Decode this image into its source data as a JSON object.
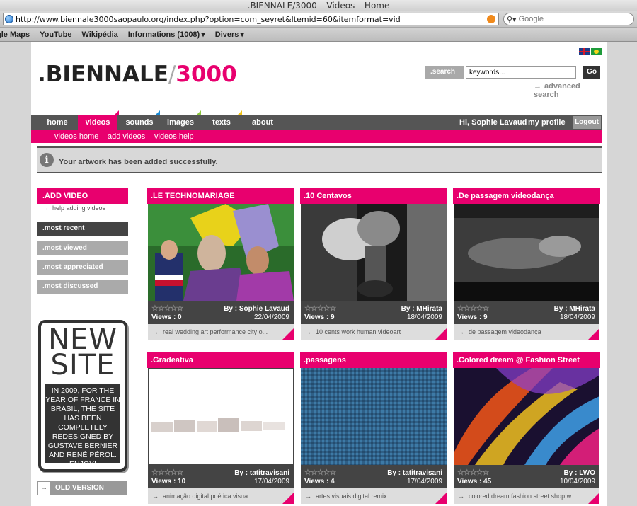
{
  "browser": {
    "title": ".BIENNALE/3000 – Videos – Home",
    "url": "http://www.biennale3000saopaulo.org/index.php?option=com_seyret&Itemid=60&itemformat=vid",
    "search_placeholder": "Google",
    "bookmarks": [
      "gle Maps",
      "YouTube",
      "Wikipédia",
      "Informations (1008)",
      "Divers"
    ]
  },
  "header": {
    "logo_part1": ".BIENNALE",
    "logo_slash": "/",
    "logo_part2": "3000",
    "search_label": ".search",
    "search_value": "keywords...",
    "go_label": "Go",
    "advanced_search": "advanced search"
  },
  "nav": {
    "items": [
      "home",
      "videos",
      "sounds",
      "images",
      "texts",
      "about"
    ],
    "greeting": "Hi, Sophie Lavaud",
    "profile": "my profile",
    "logout": "Logout",
    "sub": [
      "videos home",
      "add videos",
      "videos help"
    ]
  },
  "message": "Your artwork has been added successfully.",
  "sidebar": {
    "add_video": ".ADD VIDEO",
    "help": "help adding videos",
    "filters": [
      ".most recent",
      ".most viewed",
      ".most appreciated",
      ".most discussed"
    ],
    "newsite_big": "NEW SITE",
    "newsite_small": "IN 2009, FOR THE YEAR OF FRANCE IN BRASIL, THE SITE HAS BEEN COMPLETELY REDESIGNED BY GUSTAVE BERNIER AND RENÉ PÉROL. ENJOY!",
    "old_version": "OLD VERSION"
  },
  "videos": [
    {
      "title": ".LE TECHNOMARIAGE",
      "views": "Views : 0",
      "by": "By : Sophie Lavaud",
      "date": "22/04/2009",
      "tags": "real wedding art performance city o..."
    },
    {
      "title": ".10 Centavos",
      "views": "Views : 9",
      "by": "By : MHirata",
      "date": "18/04/2009",
      "tags": "10 cents work human videoart"
    },
    {
      "title": ".De passagem videodança",
      "views": "Views : 9",
      "by": "By : MHirata",
      "date": "18/04/2009",
      "tags": "de passagem videodança"
    },
    {
      "title": ".Gradeativa",
      "views": "Views : 10",
      "by": "By : tatitravisani",
      "date": "17/04/2009",
      "tags": "animação digital poética visua..."
    },
    {
      "title": ".passagens",
      "views": "Views : 4",
      "by": "By : tatitravisani",
      "date": "17/04/2009",
      "tags": "artes visuais digital remix"
    },
    {
      "title": ".Colored dream @ Fashion Street",
      "views": "Views : 45",
      "by": "By : LWO",
      "date": "10/04/2009",
      "tags": "colored dream fashion street shop w..."
    }
  ],
  "stars_glyph": "☆☆☆☆☆",
  "arrow_glyph": "→",
  "colors": {
    "accent": "#e8006e",
    "dark": "#444444",
    "grey": "#999999"
  }
}
